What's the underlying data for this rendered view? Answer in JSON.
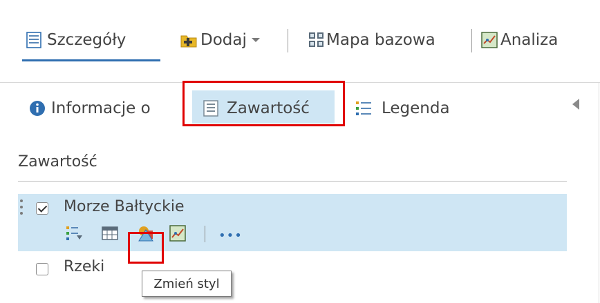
{
  "toolbar": {
    "details_label": "Szczegóły",
    "add_label": "Dodaj",
    "basemap_label": "Mapa bazowa",
    "analysis_label": "Analiza"
  },
  "tabs": {
    "info_label": "Informacje o",
    "content_label": "Zawartość",
    "legend_label": "Legenda"
  },
  "content": {
    "heading": "Zawartość",
    "layers": [
      {
        "name": "Morze Bałtyckie",
        "checked": true
      },
      {
        "name": "Rzeki",
        "checked": false
      }
    ],
    "more_label": "•••"
  },
  "tooltip": {
    "text": "Zmień styl"
  },
  "colors": {
    "accent": "#2f6eb0",
    "selection": "#cfe6f4",
    "highlight_box": "#e00000"
  }
}
